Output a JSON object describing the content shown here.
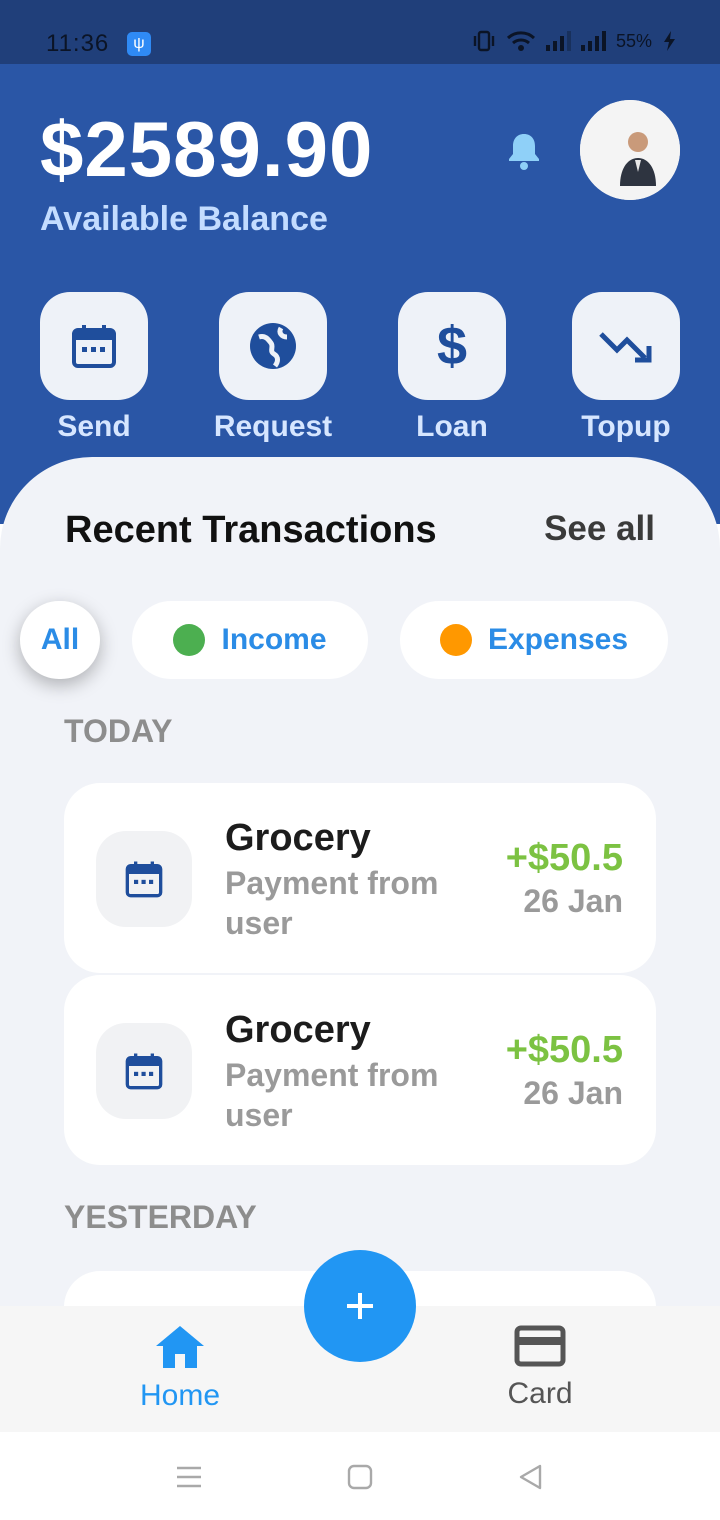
{
  "status_bar": {
    "time": "11:36",
    "battery": "55%",
    "icons": [
      "usb-icon",
      "vibrate-icon",
      "wifi-icon",
      "signal-icon",
      "signal-icon",
      "charging-icon"
    ]
  },
  "header": {
    "balance": "$2589.90",
    "balance_label": "Available Balance",
    "notification_icon": "bell-icon",
    "avatar": "user-avatar"
  },
  "quick_actions": [
    {
      "label": "Send",
      "icon": "calendar-icon"
    },
    {
      "label": "Request",
      "icon": "globe-icon"
    },
    {
      "label": "Loan",
      "icon": "dollar-icon"
    },
    {
      "label": "Topup",
      "icon": "trending-down-icon"
    }
  ],
  "transactions_section": {
    "title": "Recent Transactions",
    "see_all": "See all",
    "filters": [
      {
        "label": "All",
        "active": true
      },
      {
        "label": "Income",
        "dot_color": "#4caf50"
      },
      {
        "label": "Expenses",
        "dot_color": "#ff9800"
      }
    ],
    "groups": [
      {
        "label": "TODAY",
        "items": [
          {
            "title": "Grocery",
            "description": "Payment from user",
            "amount": "+$50.5",
            "date": "26 Jan",
            "icon": "calendar-icon"
          },
          {
            "title": "Grocery",
            "description": "Payment from user",
            "amount": "+$50.5",
            "date": "26 Jan",
            "icon": "calendar-icon"
          }
        ]
      },
      {
        "label": "YESTERDAY",
        "items": []
      }
    ]
  },
  "bottom_nav": {
    "items": [
      {
        "label": "Home",
        "icon": "home-icon",
        "active": true
      },
      {
        "label": "Card",
        "icon": "credit-card-icon",
        "active": false
      }
    ],
    "fab": "+"
  },
  "colors": {
    "header_bg": "#2a56a6",
    "accent": "#2196f3",
    "income_amount": "#7cc242",
    "sheet_bg": "#f1f3f8"
  }
}
